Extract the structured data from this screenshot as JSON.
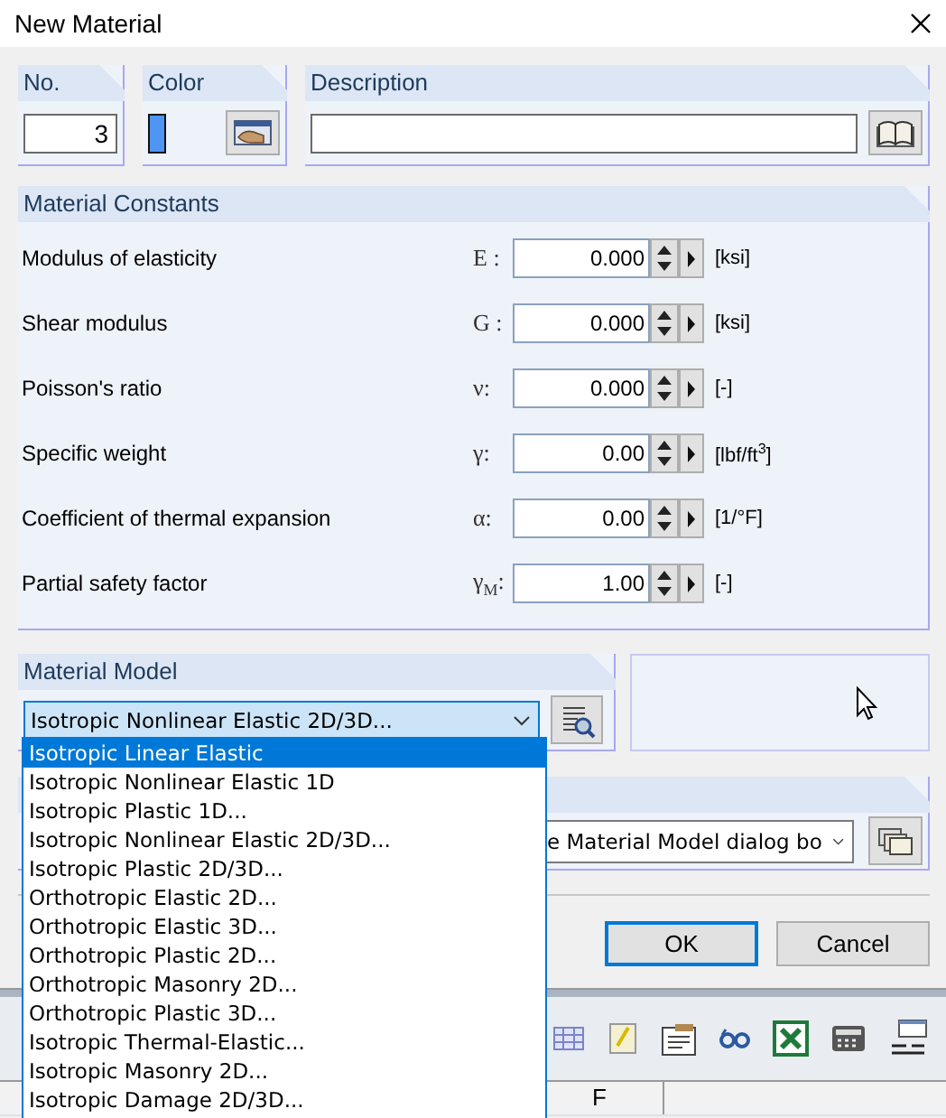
{
  "window": {
    "title": "New Material"
  },
  "number": {
    "label": "No.",
    "value": "3"
  },
  "color": {
    "label": "Color",
    "color": "#4f96f2"
  },
  "description": {
    "label": "Description"
  },
  "constants": {
    "title": "Material Constants",
    "rows": [
      {
        "name": "Modulus of elasticity",
        "symbol": "E :",
        "value": "0.000",
        "unit": "[ksi]"
      },
      {
        "name": "Shear modulus",
        "symbol": "G :",
        "value": "0.000",
        "unit": "[ksi]"
      },
      {
        "name": "Poisson's ratio",
        "symbol": "ν:",
        "value": "0.000",
        "unit": "[-]"
      },
      {
        "name": "Specific weight",
        "symbol": "γ:",
        "value": "0.00",
        "unit": "[lbf/ft$^{3}$]"
      },
      {
        "name": "Coefficient of thermal expansion",
        "symbol": "α:",
        "value": "0.00",
        "unit": "[1/°F]"
      },
      {
        "name": "Partial safety factor",
        "symbol": "γ$_{M}$:",
        "value": "1.00",
        "unit": "[-]"
      }
    ]
  },
  "material_model": {
    "title": "Material Model",
    "value": "Isotropic Nonlinear Elastic 2D/3D...",
    "options": [
      {
        "label": "Isotropic Linear Elastic",
        "highlighted": true
      },
      {
        "label": "Isotropic Nonlinear Elastic 1D",
        "highlighted": false
      },
      {
        "label": "Isotropic Plastic 1D...",
        "highlighted": false
      },
      {
        "label": "Isotropic Nonlinear Elastic 2D/3D...",
        "highlighted": false
      },
      {
        "label": "Isotropic Plastic 2D/3D...",
        "highlighted": false
      },
      {
        "label": "Orthotropic Elastic 2D...",
        "highlighted": false
      },
      {
        "label": "Orthotropic Elastic 3D...",
        "highlighted": false
      },
      {
        "label": "Orthotropic Plastic 2D...",
        "highlighted": false
      },
      {
        "label": "Orthotropic Masonry 2D...",
        "highlighted": false
      },
      {
        "label": "Orthotropic Plastic 3D...",
        "highlighted": false
      },
      {
        "label": "Isotropic Thermal-Elastic...",
        "highlighted": false
      },
      {
        "label": "Isotropic Masonry 2D...",
        "highlighted": false
      },
      {
        "label": "Isotropic Damage 2D/3D...",
        "highlighted": false
      }
    ]
  },
  "model_dialog": {
    "value": "e Material Model dialog bo"
  },
  "buttons": [
    {
      "label": "OK",
      "focused": true
    },
    {
      "label": "Cancel",
      "focused": false
    }
  ],
  "spreadsheet": {
    "column": "F"
  }
}
